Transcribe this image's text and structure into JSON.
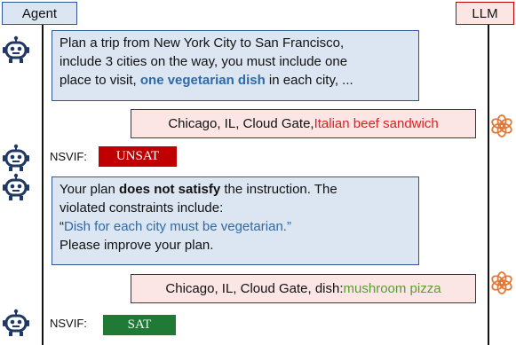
{
  "headers": {
    "agent": "Agent",
    "llm": "LLM"
  },
  "msg1": {
    "l1": "Plan a trip from New York City to San Francisco,",
    "l2": "include 3 cities on the way, you must include one",
    "l3_a": "place to visit, ",
    "l3_b": "one vegetarian dish",
    "l3_c": " in each city, ..."
  },
  "resp1": {
    "plain": "Chicago, IL, Cloud Gate, ",
    "highlight": "Italian beef sandwich"
  },
  "verdict1": {
    "label": "NSVIF:",
    "value": "UNSAT"
  },
  "feedback": {
    "l1_a": "Your plan ",
    "l1_b": "does not satisfy",
    "l1_c": " the instruction. The",
    "l2": "violated constraints include:",
    "l3_q1": "“",
    "l3_text": "Dish for each city must be vegetarian.”",
    "l4": "Please improve your plan."
  },
  "resp2": {
    "plain": "Chicago, IL, Cloud Gate, dish: ",
    "highlight": "mushroom pizza"
  },
  "verdict2": {
    "label": "NSVIF:",
    "value": "SAT"
  },
  "colors": {
    "agent_border": "#2f5597",
    "agent_fill": "#dce6f2",
    "llm_border": "#c00000",
    "llm_fill": "#fbe5e5",
    "unsat": "#c00000",
    "sat": "#1e7a35",
    "robot": "#1f3864",
    "llm_icon": "#e07b39"
  },
  "icons": {
    "agent": "robot-icon",
    "llm": "openai-knot-icon"
  }
}
